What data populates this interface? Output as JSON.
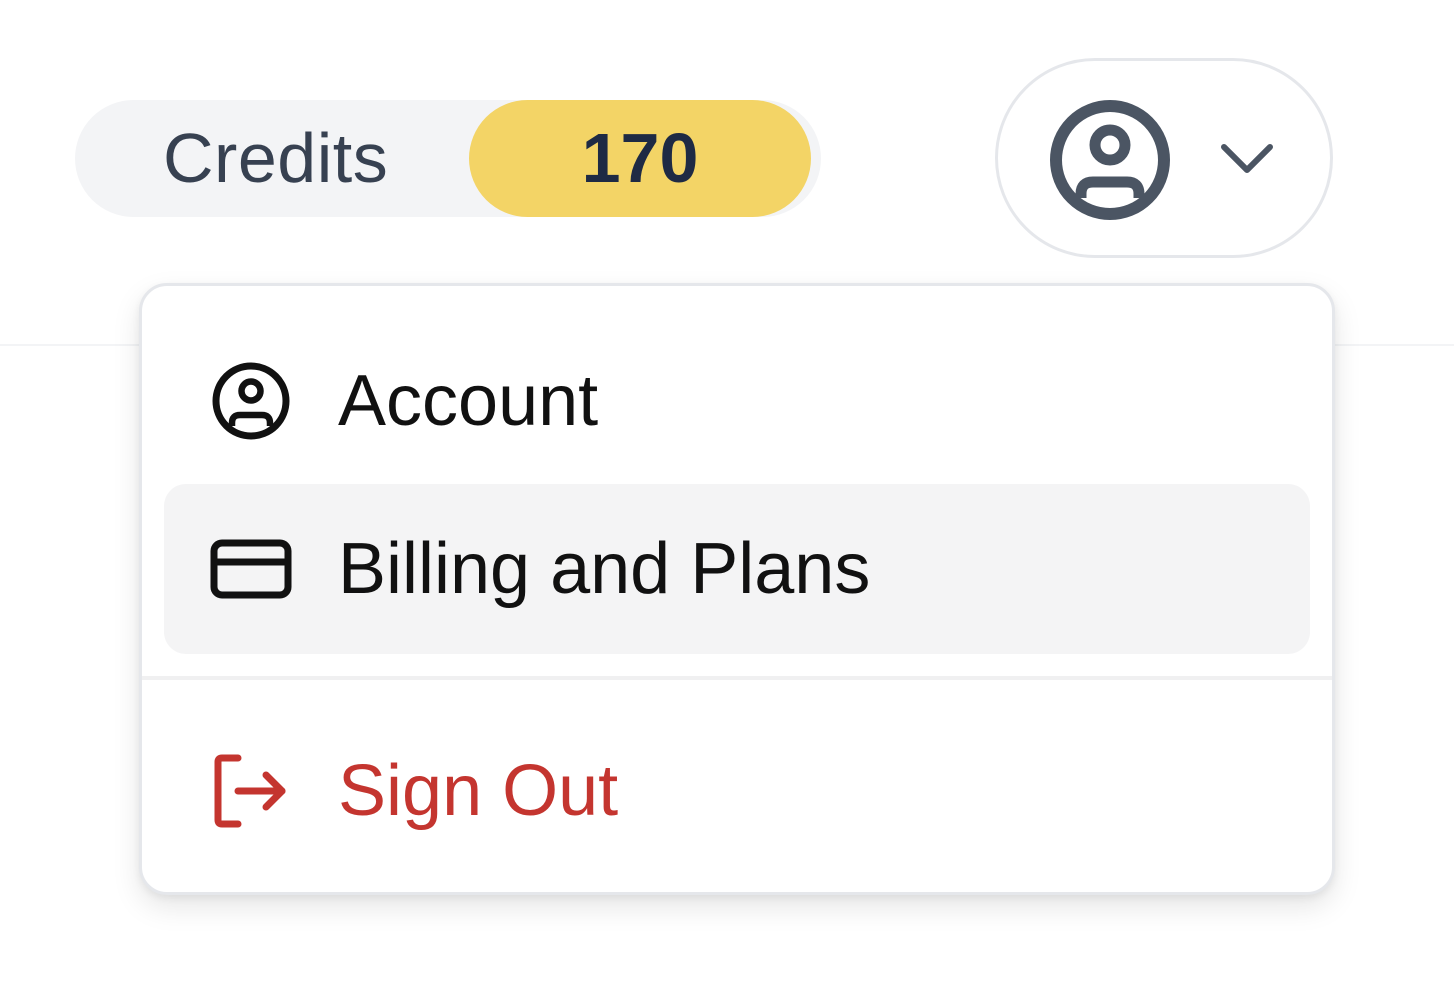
{
  "credits": {
    "label": "Credits",
    "count": "170"
  },
  "user_menu": {
    "avatar_icon": "user-circle-icon",
    "chevron_icon": "chevron-down-icon",
    "expanded": true
  },
  "dropdown": {
    "items": [
      {
        "label": "Account",
        "icon": "user-circle-icon",
        "highlighted": false,
        "danger": false
      },
      {
        "label": "Billing and Plans",
        "icon": "credit-card-icon",
        "highlighted": true,
        "danger": false
      },
      {
        "label": "Sign Out",
        "icon": "sign-out-icon",
        "highlighted": false,
        "danger": true
      }
    ]
  },
  "colors": {
    "credits_badge": "#f3d466",
    "credits_pill": "#f3f4f6",
    "danger": "#c4352f",
    "highlight": "#f4f4f5",
    "icon_gray": "#4b5563"
  }
}
